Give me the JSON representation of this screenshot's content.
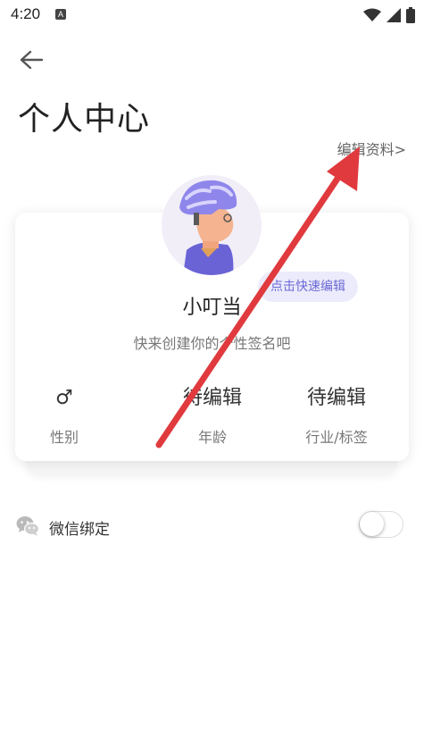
{
  "status_bar": {
    "time": "4:20",
    "notification_badge": "A"
  },
  "header": {
    "title": "个人中心",
    "edit_link": "编辑资料>"
  },
  "profile": {
    "quick_edit": "点击快速编辑",
    "nickname": "小叮当",
    "signature": "快来创建你的个性签名吧"
  },
  "stats": [
    {
      "value": "♂",
      "label": "性别"
    },
    {
      "value": "待编辑",
      "label": "年龄"
    },
    {
      "value": "待编辑",
      "label": "行业/标签"
    }
  ],
  "settings": {
    "wechat_label": "微信绑定",
    "wechat_bound": false
  },
  "colors": {
    "accent": "#6c6ad6",
    "badge_bg": "#ecebfb",
    "arrow": "#e03a3e"
  },
  "icons": [
    "back-arrow-icon",
    "wifi-icon",
    "signal-icon",
    "battery-icon",
    "wechat-icon"
  ]
}
